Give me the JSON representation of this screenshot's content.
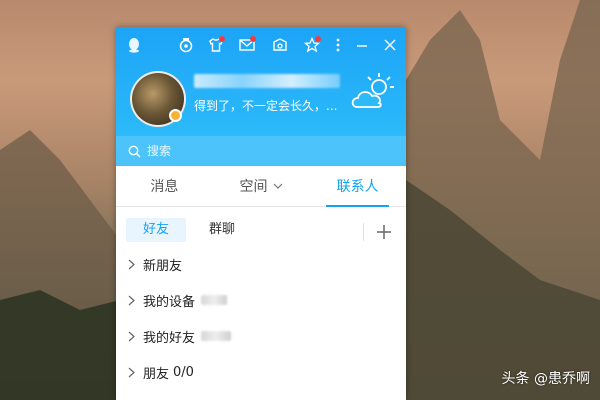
{
  "window": {
    "profile": {
      "signature": "得到了，不一定会长久，...",
      "nickname_hidden": true,
      "status": "away"
    },
    "titlebar": {
      "icons": [
        "qq-logo-icon",
        "vip-medal-icon",
        "skin-shirt-icon",
        "mail-icon",
        "box-icon",
        "star-icon",
        "more-icon",
        "minimize-icon",
        "close-icon"
      ],
      "notification_color": "#f33c3c"
    },
    "search": {
      "placeholder": "搜索"
    },
    "tabs": [
      {
        "label": "消息",
        "active": false
      },
      {
        "label": "空间",
        "active": false
      },
      {
        "label": "联系人",
        "active": true
      }
    ],
    "subtabs": [
      {
        "label": "好友",
        "active": true
      },
      {
        "label": "群聊",
        "active": false
      }
    ],
    "groups": [
      {
        "label": "新朋友",
        "count": ""
      },
      {
        "label": "我的设备",
        "count": ""
      },
      {
        "label": "我的好友",
        "count": ""
      },
      {
        "label": "朋友",
        "count": "0/0"
      }
    ],
    "colors": {
      "header_top": "#1ca4f7",
      "header_bottom": "#2cbaf9",
      "accent": "#12a3f2"
    }
  },
  "watermark": {
    "text": "头条 @患乔啊"
  }
}
